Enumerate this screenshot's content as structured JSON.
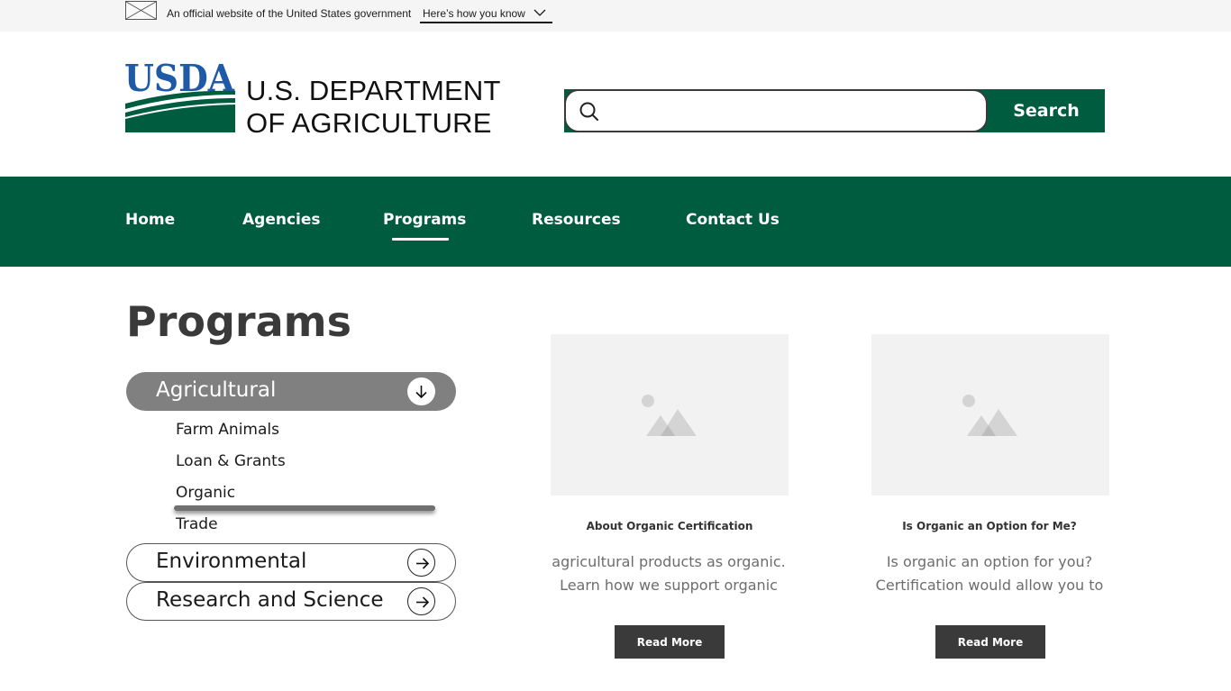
{
  "gov_banner": {
    "text": "An official website of the United States government",
    "link": "Here’s how you know"
  },
  "header": {
    "logo_text": "USDA",
    "agency_line1": "U.S. DEPARTMENT",
    "agency_line2": "OF AGRICULTURE",
    "search_placeholder": "",
    "search_button": "Search"
  },
  "nav": {
    "items": [
      "Home",
      "Agencies",
      "Programs",
      "Resources",
      "Contact Us"
    ],
    "active": "Programs"
  },
  "main": {
    "title": "Programs",
    "accordion": [
      {
        "label": "Agricultural",
        "expanded": true,
        "children": [
          "Farm Animals",
          "Loan & Grants",
          "Organic",
          "Trade"
        ],
        "selected_child": "Organic"
      },
      {
        "label": "Environmental",
        "expanded": false
      },
      {
        "label": "Research and Science",
        "expanded": false
      }
    ],
    "cards": [
      {
        "title": "About Organic Certification",
        "body_line1": "agricultural products as organic.",
        "body_line2": "Learn how we support organic",
        "button": "Read More"
      },
      {
        "title": "Is Organic an Option for Me?",
        "body_line1": "Is organic an option for you?",
        "body_line2": "Certification would allow you to",
        "button": "Read More"
      }
    ]
  },
  "colors": {
    "brand_green": "#005c3f",
    "usda_blue": "#1f5aa6",
    "accordion_active": "#808080",
    "button_dark": "#3a3a3a",
    "image_placeholder": "#f2f2f2"
  }
}
